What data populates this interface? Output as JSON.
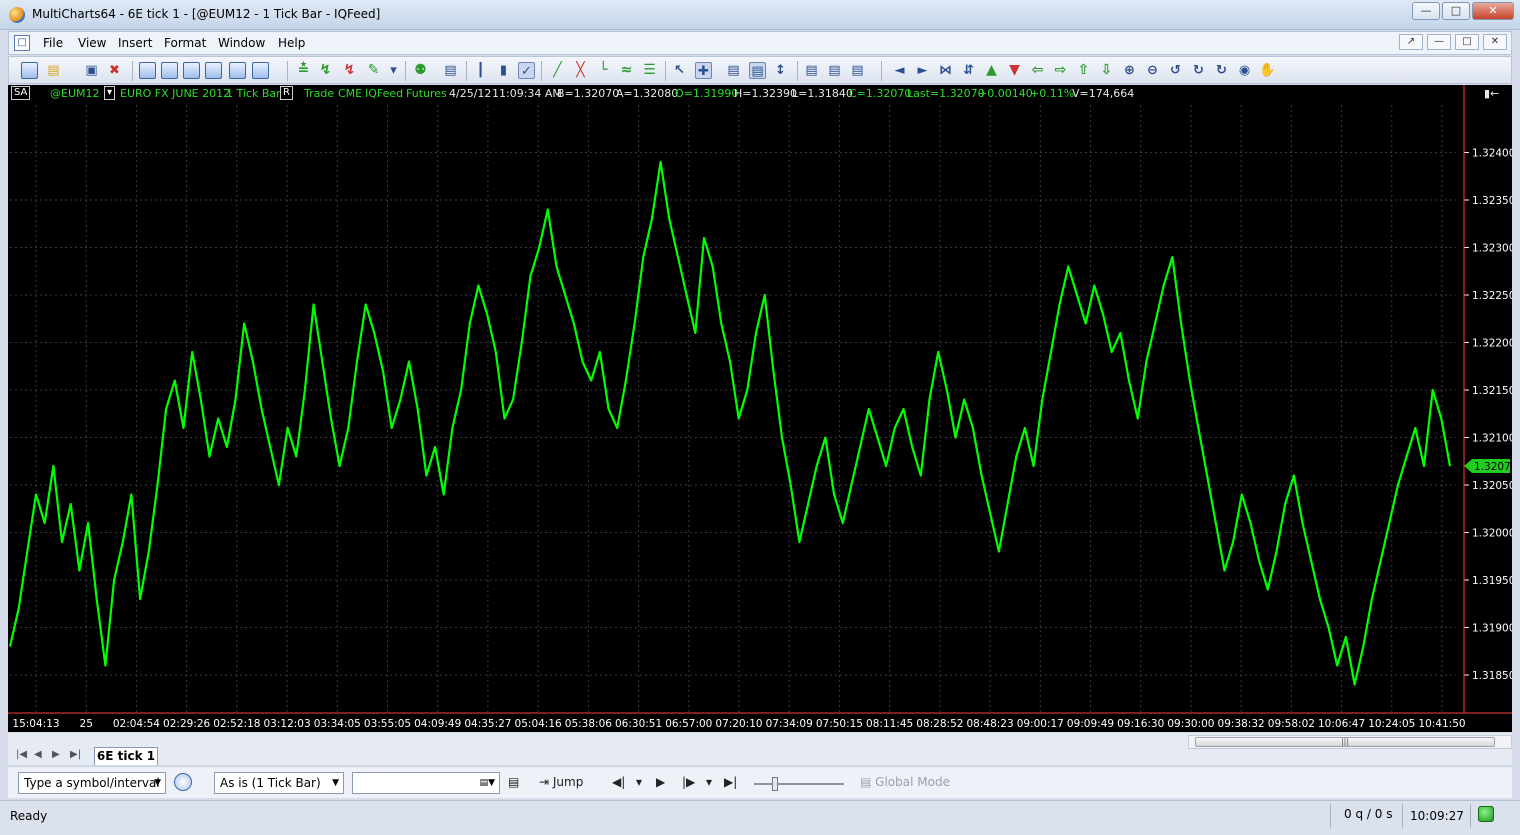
{
  "window": {
    "title": "MultiCharts64 - 6E tick 1 - [@EUM12 - 1 Tick Bar - IQFeed]",
    "buttons": [
      "minimize",
      "maximize",
      "close"
    ]
  },
  "menu": [
    "File",
    "View",
    "Insert",
    "Format",
    "Window",
    "Help"
  ],
  "status_line": {
    "mode": "SA",
    "symbol": "@EUM12",
    "description": "EURO FX JUNE 2012",
    "resolution": "1 Tick Bar",
    "r_flag": "R",
    "data_type": "Trade",
    "exchange": "CME",
    "feed": "IQFeed",
    "category": "Futures",
    "date": "4/25/12",
    "time": "11:09:34 AM",
    "bid": "B=1.32070",
    "ask": "A=1.32080",
    "open": "O=1.31990",
    "high": "H=1.32390",
    "low": "L=1.31840",
    "close": "C=1.32070",
    "last": "Last=1.32070",
    "change": "+0.00140",
    "change_pct": "+0.11%",
    "volume": "V=174,664"
  },
  "chart_data": {
    "type": "line",
    "series": [
      {
        "name": "@EUM12",
        "color": "#00ff00",
        "values": [
          1.3188,
          1.3192,
          1.3198,
          1.3204,
          1.3201,
          1.3207,
          1.3199,
          1.3203,
          1.3196,
          1.3201,
          1.3193,
          1.3186,
          1.3195,
          1.3199,
          1.3204,
          1.3193,
          1.3198,
          1.3205,
          1.3213,
          1.3216,
          1.3211,
          1.3219,
          1.3214,
          1.3208,
          1.3212,
          1.3209,
          1.3214,
          1.3222,
          1.3218,
          1.3213,
          1.3209,
          1.3205,
          1.3211,
          1.3208,
          1.3215,
          1.3224,
          1.3218,
          1.3212,
          1.3207,
          1.3211,
          1.3218,
          1.3224,
          1.3221,
          1.3217,
          1.3211,
          1.3214,
          1.3218,
          1.3213,
          1.3206,
          1.3209,
          1.3204,
          1.3211,
          1.3215,
          1.3222,
          1.3226,
          1.3223,
          1.3219,
          1.3212,
          1.3214,
          1.322,
          1.3227,
          1.323,
          1.3234,
          1.3228,
          1.3225,
          1.3222,
          1.3218,
          1.3216,
          1.3219,
          1.3213,
          1.3211,
          1.3216,
          1.3222,
          1.3229,
          1.3233,
          1.3239,
          1.3233,
          1.3229,
          1.3225,
          1.3221,
          1.3231,
          1.3228,
          1.3222,
          1.3218,
          1.3212,
          1.3215,
          1.3221,
          1.3225,
          1.3217,
          1.321,
          1.3205,
          1.3199,
          1.3203,
          1.3207,
          1.321,
          1.3204,
          1.3201,
          1.3205,
          1.3209,
          1.3213,
          1.321,
          1.3207,
          1.3211,
          1.3213,
          1.3209,
          1.3206,
          1.3214,
          1.3219,
          1.3215,
          1.321,
          1.3214,
          1.3211,
          1.3206,
          1.3202,
          1.3198,
          1.3203,
          1.3208,
          1.3211,
          1.3207,
          1.3214,
          1.3219,
          1.3224,
          1.3228,
          1.3225,
          1.3222,
          1.3226,
          1.3223,
          1.3219,
          1.3221,
          1.3216,
          1.3212,
          1.3218,
          1.3222,
          1.3226,
          1.3229,
          1.3222,
          1.3216,
          1.3211,
          1.3206,
          1.3201,
          1.3196,
          1.3199,
          1.3204,
          1.3201,
          1.3197,
          1.3194,
          1.3198,
          1.3203,
          1.3206,
          1.3201,
          1.3197,
          1.3193,
          1.319,
          1.3186,
          1.3189,
          1.3184,
          1.3188,
          1.3193,
          1.3197,
          1.3201,
          1.3205,
          1.3208,
          1.3211,
          1.3207,
          1.3215,
          1.3212,
          1.3207
        ]
      }
    ],
    "x_tick_labels": [
      "15:04:13",
      "25",
      "02:04:54",
      "02:29:26",
      "02:52:18",
      "03:12:03",
      "03:34:05",
      "03:55:05",
      "04:09:49",
      "04:35:27",
      "05:04:16",
      "05:38:06",
      "06:30:51",
      "06:57:00",
      "07:20:10",
      "07:34:09",
      "07:50:15",
      "08:11:45",
      "08:28:52",
      "08:48:23",
      "09:00:17",
      "09:09:49",
      "09:16:30",
      "09:30:00",
      "09:38:32",
      "09:58:02",
      "10:06:47",
      "10:24:05",
      "10:41:50"
    ],
    "y_tick_labels": [
      "1.32400",
      "1.32350",
      "1.32300",
      "1.32250",
      "1.32200",
      "1.32150",
      "1.32100",
      "1.32050",
      "1.32000",
      "1.31950",
      "1.31900",
      "1.31850"
    ],
    "ylim": [
      1.3181,
      1.3245
    ],
    "last_price_label": "1.32070",
    "grid": true,
    "background": "#000000",
    "axis_line_color": "#ff3b3b"
  },
  "tabs": {
    "active": "6E tick 1"
  },
  "bottom": {
    "symbol_input": "Type a symbol/interval",
    "resolution_select": "As is (1 Tick Bar)",
    "jump_label": "Jump",
    "global_mode_label": "Global Mode"
  },
  "status": {
    "ready": "Ready",
    "queue": "0 q / 0 s",
    "clock": "10:09:27"
  }
}
